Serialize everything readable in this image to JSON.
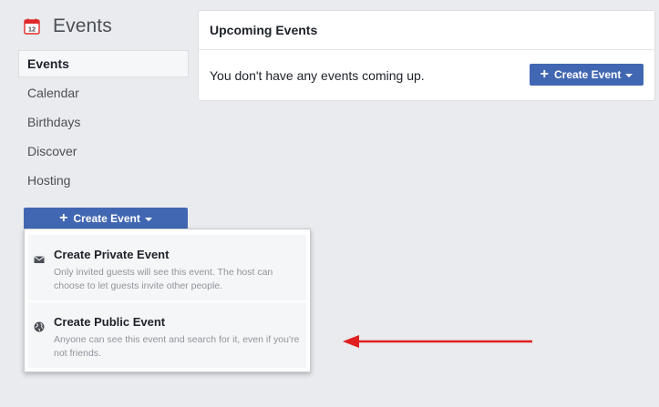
{
  "sidebar": {
    "title": "Events",
    "calendar_icon_day": "12",
    "items": [
      {
        "label": "Events",
        "active": true
      },
      {
        "label": "Calendar",
        "active": false
      },
      {
        "label": "Birthdays",
        "active": false
      },
      {
        "label": "Discover",
        "active": false
      },
      {
        "label": "Hosting",
        "active": false
      }
    ],
    "create_button_label": "Create Event"
  },
  "dropdown": {
    "private": {
      "icon": "envelope-icon",
      "title": "Create Private Event",
      "description": "Only invited guests will see this event. The host can choose to let guests invite other people."
    },
    "public": {
      "icon": "globe-icon",
      "title": "Create Public Event",
      "description": "Anyone can see this event and search for it, even if you're not friends."
    }
  },
  "upcoming": {
    "header": "Upcoming Events",
    "empty_message": "You don't have any events coming up.",
    "create_button_label": "Create Event"
  },
  "colors": {
    "brand_blue": "#4267b2",
    "calendar_red": "#e02a2a",
    "arrow_red": "#e02020",
    "page_bg": "#e9ebee"
  }
}
